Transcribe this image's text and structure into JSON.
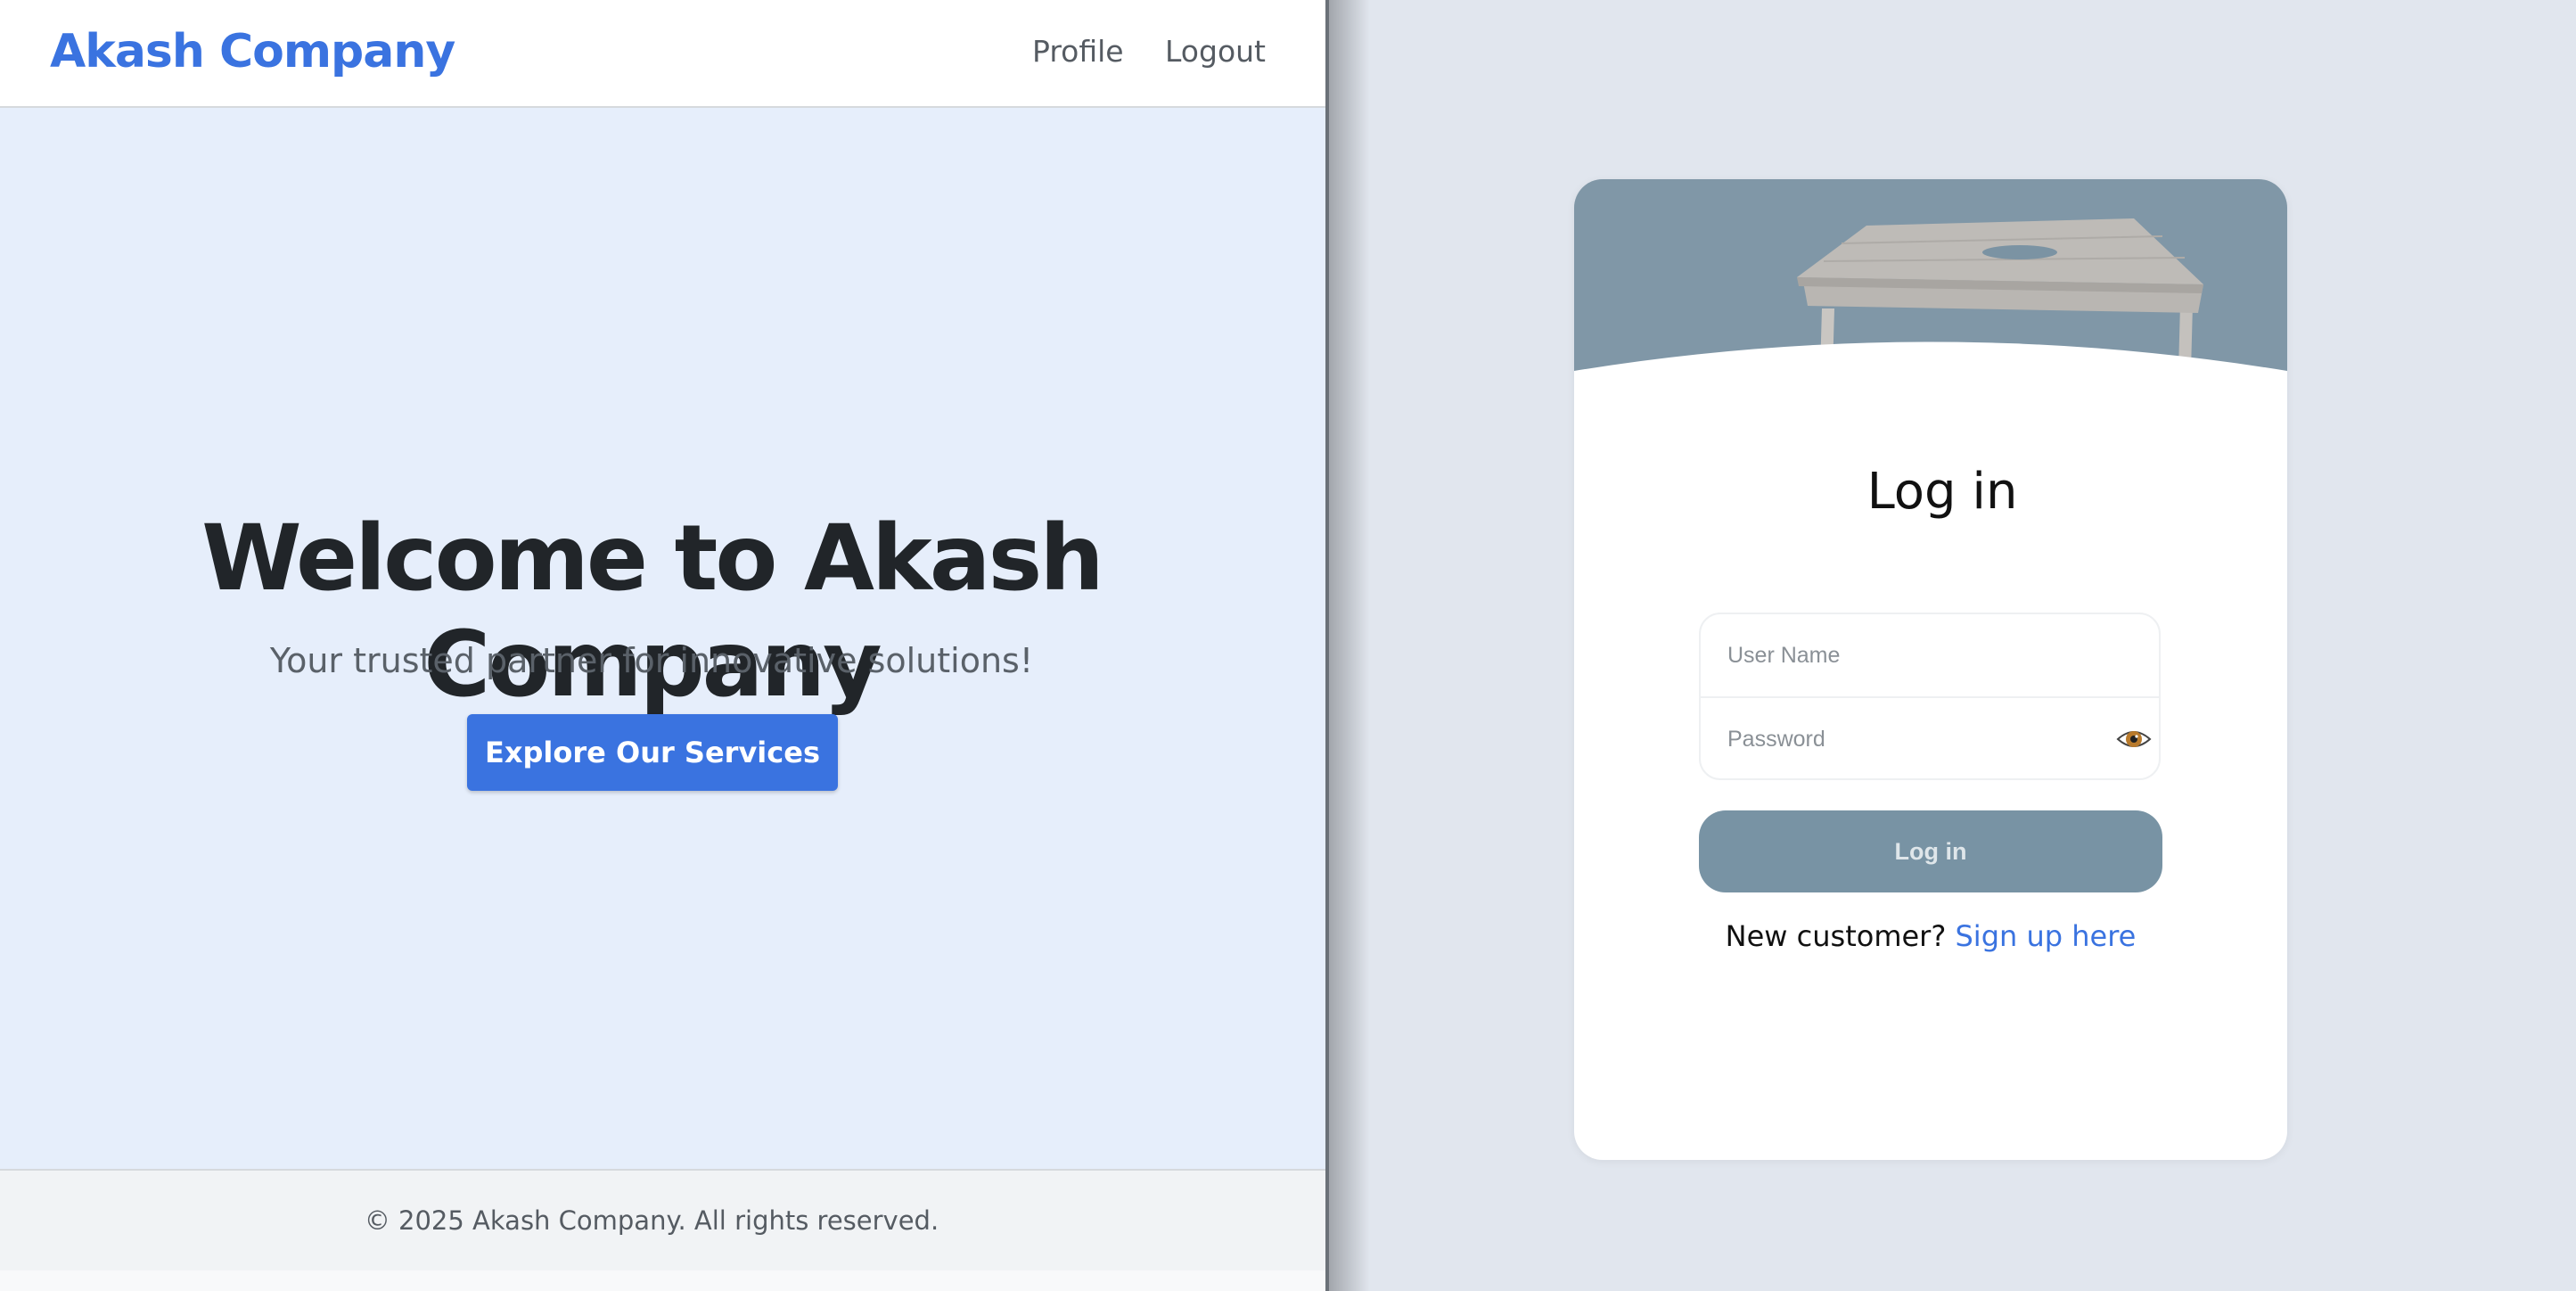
{
  "site": {
    "brand": "Akash Company",
    "nav": {
      "profile": "Profile",
      "logout": "Logout"
    }
  },
  "hero": {
    "title": "Welcome to Akash Company",
    "subtitle": "Your trusted partner for innovative solutions!",
    "cta": "Explore Our Services"
  },
  "footer": {
    "text": "© 2025 Akash Company. All rights reserved."
  },
  "login": {
    "title": "Log in",
    "username_placeholder": "User Name",
    "password_placeholder": "Password",
    "show_password_icon": "eye-icon",
    "button": "Log in",
    "signup_prompt": "New customer?",
    "signup_link": "Sign up here"
  },
  "colors": {
    "brand": "#3a73e0",
    "login_button": "#7893a4",
    "hero_bg": "#e6eefb",
    "page_bg_right": "#e1e6ee"
  }
}
